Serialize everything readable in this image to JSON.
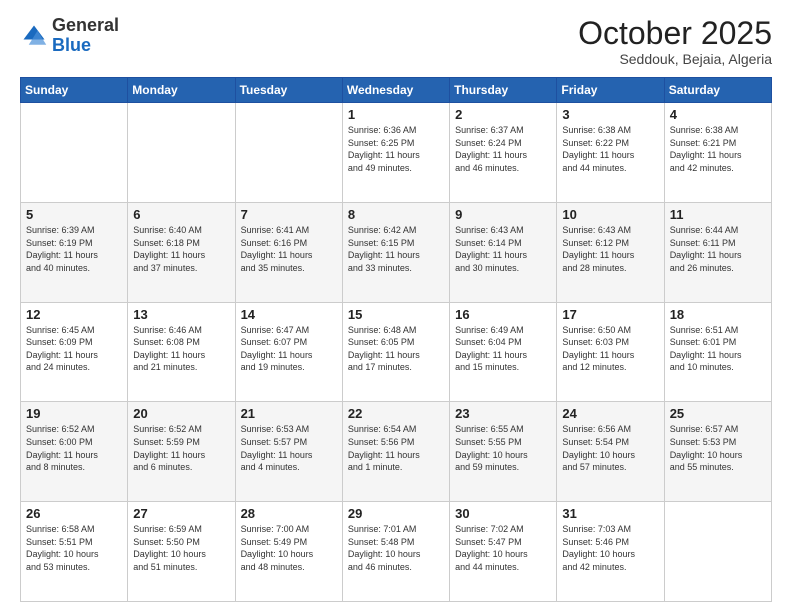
{
  "header": {
    "logo_general": "General",
    "logo_blue": "Blue",
    "month": "October 2025",
    "location": "Seddouk, Bejaia, Algeria"
  },
  "days_of_week": [
    "Sunday",
    "Monday",
    "Tuesday",
    "Wednesday",
    "Thursday",
    "Friday",
    "Saturday"
  ],
  "weeks": [
    [
      {
        "day": "",
        "info": ""
      },
      {
        "day": "",
        "info": ""
      },
      {
        "day": "",
        "info": ""
      },
      {
        "day": "1",
        "info": "Sunrise: 6:36 AM\nSunset: 6:25 PM\nDaylight: 11 hours\nand 49 minutes."
      },
      {
        "day": "2",
        "info": "Sunrise: 6:37 AM\nSunset: 6:24 PM\nDaylight: 11 hours\nand 46 minutes."
      },
      {
        "day": "3",
        "info": "Sunrise: 6:38 AM\nSunset: 6:22 PM\nDaylight: 11 hours\nand 44 minutes."
      },
      {
        "day": "4",
        "info": "Sunrise: 6:38 AM\nSunset: 6:21 PM\nDaylight: 11 hours\nand 42 minutes."
      }
    ],
    [
      {
        "day": "5",
        "info": "Sunrise: 6:39 AM\nSunset: 6:19 PM\nDaylight: 11 hours\nand 40 minutes."
      },
      {
        "day": "6",
        "info": "Sunrise: 6:40 AM\nSunset: 6:18 PM\nDaylight: 11 hours\nand 37 minutes."
      },
      {
        "day": "7",
        "info": "Sunrise: 6:41 AM\nSunset: 6:16 PM\nDaylight: 11 hours\nand 35 minutes."
      },
      {
        "day": "8",
        "info": "Sunrise: 6:42 AM\nSunset: 6:15 PM\nDaylight: 11 hours\nand 33 minutes."
      },
      {
        "day": "9",
        "info": "Sunrise: 6:43 AM\nSunset: 6:14 PM\nDaylight: 11 hours\nand 30 minutes."
      },
      {
        "day": "10",
        "info": "Sunrise: 6:43 AM\nSunset: 6:12 PM\nDaylight: 11 hours\nand 28 minutes."
      },
      {
        "day": "11",
        "info": "Sunrise: 6:44 AM\nSunset: 6:11 PM\nDaylight: 11 hours\nand 26 minutes."
      }
    ],
    [
      {
        "day": "12",
        "info": "Sunrise: 6:45 AM\nSunset: 6:09 PM\nDaylight: 11 hours\nand 24 minutes."
      },
      {
        "day": "13",
        "info": "Sunrise: 6:46 AM\nSunset: 6:08 PM\nDaylight: 11 hours\nand 21 minutes."
      },
      {
        "day": "14",
        "info": "Sunrise: 6:47 AM\nSunset: 6:07 PM\nDaylight: 11 hours\nand 19 minutes."
      },
      {
        "day": "15",
        "info": "Sunrise: 6:48 AM\nSunset: 6:05 PM\nDaylight: 11 hours\nand 17 minutes."
      },
      {
        "day": "16",
        "info": "Sunrise: 6:49 AM\nSunset: 6:04 PM\nDaylight: 11 hours\nand 15 minutes."
      },
      {
        "day": "17",
        "info": "Sunrise: 6:50 AM\nSunset: 6:03 PM\nDaylight: 11 hours\nand 12 minutes."
      },
      {
        "day": "18",
        "info": "Sunrise: 6:51 AM\nSunset: 6:01 PM\nDaylight: 11 hours\nand 10 minutes."
      }
    ],
    [
      {
        "day": "19",
        "info": "Sunrise: 6:52 AM\nSunset: 6:00 PM\nDaylight: 11 hours\nand 8 minutes."
      },
      {
        "day": "20",
        "info": "Sunrise: 6:52 AM\nSunset: 5:59 PM\nDaylight: 11 hours\nand 6 minutes."
      },
      {
        "day": "21",
        "info": "Sunrise: 6:53 AM\nSunset: 5:57 PM\nDaylight: 11 hours\nand 4 minutes."
      },
      {
        "day": "22",
        "info": "Sunrise: 6:54 AM\nSunset: 5:56 PM\nDaylight: 11 hours\nand 1 minute."
      },
      {
        "day": "23",
        "info": "Sunrise: 6:55 AM\nSunset: 5:55 PM\nDaylight: 10 hours\nand 59 minutes."
      },
      {
        "day": "24",
        "info": "Sunrise: 6:56 AM\nSunset: 5:54 PM\nDaylight: 10 hours\nand 57 minutes."
      },
      {
        "day": "25",
        "info": "Sunrise: 6:57 AM\nSunset: 5:53 PM\nDaylight: 10 hours\nand 55 minutes."
      }
    ],
    [
      {
        "day": "26",
        "info": "Sunrise: 6:58 AM\nSunset: 5:51 PM\nDaylight: 10 hours\nand 53 minutes."
      },
      {
        "day": "27",
        "info": "Sunrise: 6:59 AM\nSunset: 5:50 PM\nDaylight: 10 hours\nand 51 minutes."
      },
      {
        "day": "28",
        "info": "Sunrise: 7:00 AM\nSunset: 5:49 PM\nDaylight: 10 hours\nand 48 minutes."
      },
      {
        "day": "29",
        "info": "Sunrise: 7:01 AM\nSunset: 5:48 PM\nDaylight: 10 hours\nand 46 minutes."
      },
      {
        "day": "30",
        "info": "Sunrise: 7:02 AM\nSunset: 5:47 PM\nDaylight: 10 hours\nand 44 minutes."
      },
      {
        "day": "31",
        "info": "Sunrise: 7:03 AM\nSunset: 5:46 PM\nDaylight: 10 hours\nand 42 minutes."
      },
      {
        "day": "",
        "info": ""
      }
    ]
  ]
}
